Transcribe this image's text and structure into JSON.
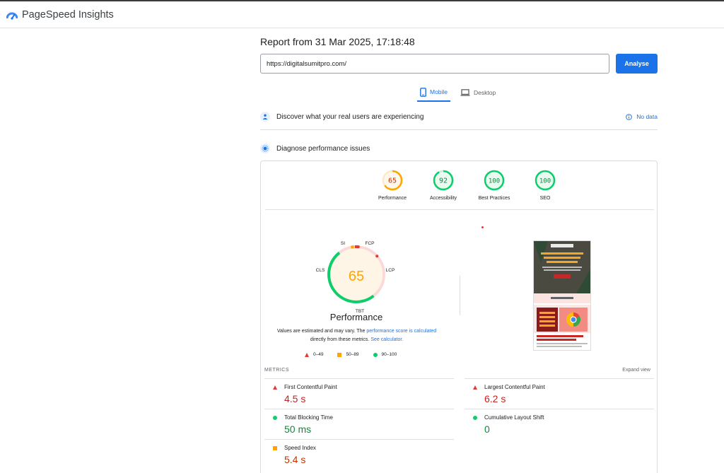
{
  "app": {
    "title": "PageSpeed Insights"
  },
  "report": {
    "title": "Report from 31 Mar 2025, 17:18:48"
  },
  "search": {
    "url": "https://digitalsumitpro.com/",
    "button_label": "Analyse"
  },
  "tabs": [
    {
      "label": "Mobile",
      "active": true,
      "icon": "phone-icon"
    },
    {
      "label": "Desktop",
      "active": false,
      "icon": "laptop-icon"
    }
  ],
  "sections": {
    "field": {
      "label": "Discover what your real users are experiencing",
      "status": "No data"
    },
    "lab": {
      "label": "Diagnose performance issues"
    }
  },
  "scores": [
    {
      "label": "Performance",
      "value": "65",
      "color": "#ffa400"
    },
    {
      "label": "Accessibility",
      "value": "92",
      "color": "#0cce6b"
    },
    {
      "label": "Best Practices",
      "value": "100",
      "color": "#0cce6b"
    },
    {
      "label": "SEO",
      "value": "100",
      "color": "#0cce6b"
    }
  ],
  "main_gauge": {
    "value": "65",
    "title": "Performance",
    "labels": {
      "si": "SI",
      "fcp": "FCP",
      "lcp": "LCP",
      "tbt": "TBT",
      "cls": "CLS"
    }
  },
  "note": {
    "text1": "Values are estimated and may vary. The ",
    "link1": "performance score is calculated",
    "text2": "directly from these metrics. ",
    "link2": "See calculator."
  },
  "legend": [
    {
      "label": "0–49",
      "shape": "triangle",
      "color": "#e53935"
    },
    {
      "label": "50–89",
      "shape": "square",
      "color": "#ffa400"
    },
    {
      "label": "90–100",
      "shape": "circle",
      "color": "#0cce6b"
    }
  ],
  "metrics_header": {
    "title": "METRICS",
    "expand": "Expand view"
  },
  "metrics": [
    {
      "name": "First Contentful Paint",
      "value": "4.5 s",
      "rating": "poor"
    },
    {
      "name": "Largest Contentful Paint",
      "value": "6.2 s",
      "rating": "poor"
    },
    {
      "name": "Total Blocking Time",
      "value": "50 ms",
      "rating": "good"
    },
    {
      "name": "Cumulative Layout Shift",
      "value": "0",
      "rating": "good"
    },
    {
      "name": "Speed Index",
      "value": "5.4 s",
      "rating": "average"
    }
  ],
  "colors": {
    "accent": "#1a73e8",
    "poor": "#e53935",
    "average": "#ffa400",
    "good": "#0cce6b"
  }
}
